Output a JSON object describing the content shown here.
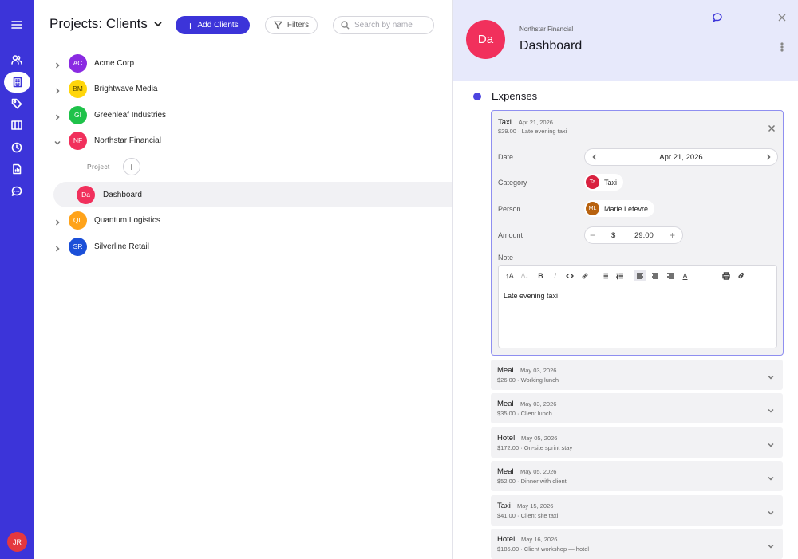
{
  "rail": {
    "user_initials": "JR"
  },
  "header": {
    "title": "Projects: Clients",
    "add_label": "Add Clients",
    "filter_label": "Filters",
    "search_placeholder": "Search by name"
  },
  "clients": [
    {
      "initials": "AC",
      "name": "Acme Corp",
      "color": "#8a2be2"
    },
    {
      "initials": "BM",
      "name": "Brightwave Media",
      "color": "#ffd60a"
    },
    {
      "initials": "GI",
      "name": "Greenleaf Industries",
      "color": "#1fc24a"
    },
    {
      "initials": "NF",
      "name": "Northstar Financial",
      "color": "#f1305c"
    },
    {
      "initials": "QL",
      "name": "Quantum Logistics",
      "color": "#ffa31a"
    },
    {
      "initials": "SR",
      "name": "Silverline Retail",
      "color": "#1b4fd8"
    }
  ],
  "project": {
    "label": "Project",
    "initials": "Da",
    "name": "Dashboard",
    "color": "#f1305c"
  },
  "panel": {
    "initials": "Da",
    "breadcrumb": "Northstar Financial",
    "title": "Dashboard",
    "section": "Expenses",
    "expanded": {
      "type": "Taxi",
      "date": "Apr 21, 2026",
      "summary": "$29.00 · Late evening taxi",
      "labels": {
        "date": "Date",
        "category": "Category",
        "person": "Person",
        "amount": "Amount",
        "note": "Note"
      },
      "date_value": "Apr 21, 2026",
      "category": {
        "initials": "Ta",
        "name": "Taxi",
        "color": "#d9213f"
      },
      "person": {
        "initials": "ML",
        "name": "Marie Lefevre",
        "color": "#b8620f"
      },
      "currency": "$",
      "amount": "29.00",
      "note": "Late evening taxi"
    },
    "items": [
      {
        "type": "Meal",
        "date": "May 03, 2026",
        "summary": "$26.00 · Working lunch"
      },
      {
        "type": "Meal",
        "date": "May 03, 2026",
        "summary": "$35.00 · Client lunch"
      },
      {
        "type": "Hotel",
        "date": "May 05, 2026",
        "summary": "$172.00 · On-site sprint stay"
      },
      {
        "type": "Meal",
        "date": "May 05, 2026",
        "summary": "$52.00 · Dinner with client"
      },
      {
        "type": "Taxi",
        "date": "May 15, 2026",
        "summary": "$41.00 · Client site taxi"
      },
      {
        "type": "Hotel",
        "date": "May 16, 2026",
        "summary": "$185.00 · Client workshop — hotel"
      }
    ]
  }
}
